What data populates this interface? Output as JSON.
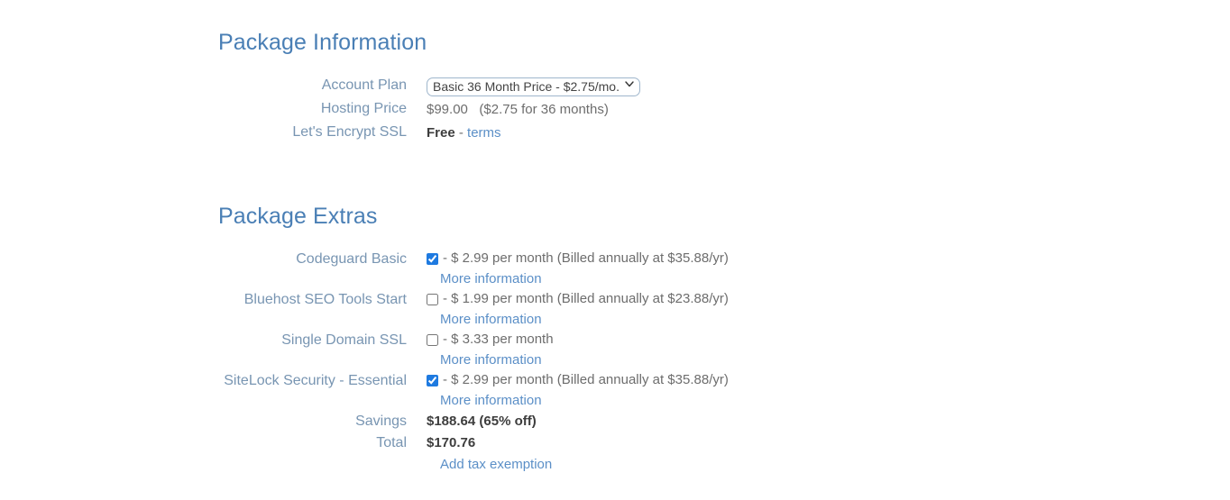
{
  "package_information": {
    "heading": "Package Information",
    "rows": [
      {
        "label": "Account Plan",
        "type": "select",
        "selected": "Basic 36 Month Price - $2.75/mo.",
        "options": [
          "Basic 36 Month Price - $2.75/mo."
        ]
      },
      {
        "label": "Hosting Price",
        "type": "price",
        "amount": "$99.00",
        "detail": "($2.75 for 36 months)"
      },
      {
        "label": "Let's Encrypt SSL",
        "type": "free",
        "value": "Free",
        "separator": "-",
        "link": "terms"
      }
    ]
  },
  "package_extras": {
    "heading": "Package Extras",
    "items": [
      {
        "label": "Codeguard Basic",
        "checked": true,
        "description": "- $ 2.99 per month (Billed annually at $35.88/yr)",
        "more_link": "More information"
      },
      {
        "label": "Bluehost SEO Tools Start",
        "checked": false,
        "description": "- $ 1.99 per month (Billed annually at $23.88/yr)",
        "more_link": "More information"
      },
      {
        "label": "Single Domain SSL",
        "checked": false,
        "description": "- $ 3.33 per month",
        "more_link": "More information"
      },
      {
        "label": "SiteLock Security - Essential",
        "checked": true,
        "description": "- $ 2.99 per month (Billed annually at $35.88/yr)",
        "more_link": "More information"
      }
    ],
    "summary": {
      "savings_label": "Savings",
      "savings_value": "$188.64 (65% off)",
      "total_label": "Total",
      "total_value": "$170.76",
      "tax_link": "Add tax exemption"
    }
  },
  "colors": {
    "heading": "#4a7fb5",
    "label": "#7895b2",
    "link": "#5b8fc7",
    "value": "#6d6d6d",
    "bold_value": "#3d3d3d",
    "checkbox_accent": "#1e7ae0",
    "background": "#ffffff"
  }
}
